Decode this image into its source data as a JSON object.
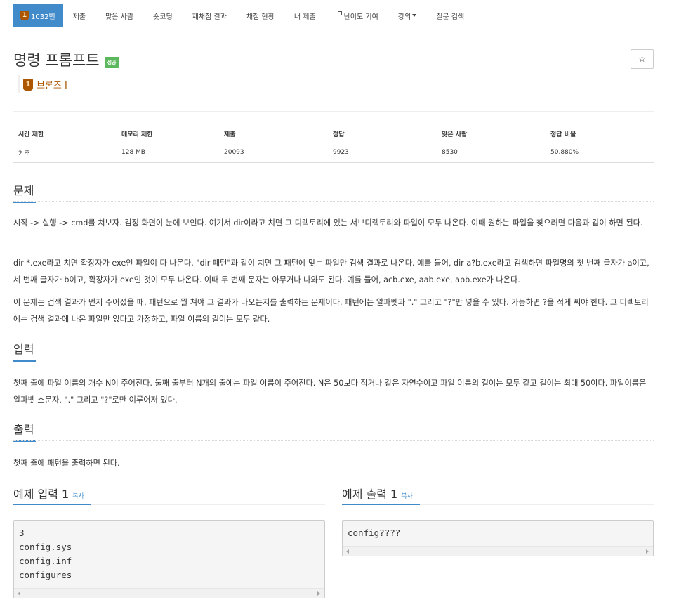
{
  "nav": {
    "problem_number": "1032번",
    "medal_digit": "1",
    "items": [
      "제출",
      "맞은 사람",
      "숏코딩",
      "재채점 결과",
      "채점 현황",
      "내 제출"
    ],
    "difficulty": "난이도 기여",
    "lecture": "강의",
    "qna": "질문 검색"
  },
  "problem": {
    "title": "명령 프롬프트",
    "status_badge": "성공",
    "tier": "브론즈 I",
    "star": "☆"
  },
  "colors": {
    "accent": "#428bca",
    "bronze": "#ad5600",
    "success": "#5cb85c"
  },
  "info_table": {
    "headers": [
      "시간 제한",
      "메모리 제한",
      "제출",
      "정답",
      "맞은 사람",
      "정답 비율"
    ],
    "row": [
      "2 초",
      "128 MB",
      "20093",
      "9923",
      "8530",
      "50.880%"
    ]
  },
  "sections": {
    "problem": {
      "heading": "문제",
      "paragraphs": [
        "시작 -> 실행 -> cmd를 쳐보자. 검정 화면이 눈에 보인다. 여기서 dir이라고 치면 그 디렉토리에 있는 서브디렉토리와 파일이 모두 나온다. 이때 원하는 파일을 찾으려면 다음과 같이 하면 된다.",
        "dir *.exe라고 치면 확장자가 exe인 파일이 다 나온다. \"dir 패턴\"과 같이 치면 그 패턴에 맞는 파일만 검색 결과로 나온다. 예를 들어, dir a?b.exe라고 검색하면 파일명의 첫 번째 글자가 a이고, 세 번째 글자가 b이고, 확장자가 exe인 것이 모두 나온다. 이때 두 번째 문자는 아무거나 나와도 된다. 예를 들어, acb.exe, aab.exe, apb.exe가 나온다.",
        "이 문제는 검색 결과가 먼저 주어졌을 때, 패턴으로 뭘 쳐야 그 결과가 나오는지를 출력하는 문제이다. 패턴에는 알파벳과 \".\" 그리고 \"?\"만 넣을 수 있다. 가능하면 ?을 적게 써야 한다. 그 디렉토리에는 검색 결과에 나온 파일만 있다고 가정하고, 파일 이름의 길이는 모두 같다."
      ]
    },
    "input": {
      "heading": "입력",
      "text": "첫째 줄에 파일 이름의 개수 N이 주어진다. 둘째 줄부터 N개의 줄에는 파일 이름이 주어진다. N은 50보다 작거나 같은 자연수이고 파일 이름의 길이는 모두 같고 길이는 최대 50이다. 파일이름은 알파벳 소문자, \".\" 그리고 \"?\"로만 이루어져 있다."
    },
    "output": {
      "heading": "출력",
      "text": "첫째 줄에 패턴을 출력하면 된다."
    }
  },
  "samples": {
    "input_title": "예제 입력 1",
    "output_title": "예제 출력 1",
    "copy_label": "복사",
    "input_code": "3\nconfig.sys\nconfig.inf\nconfigures",
    "output_code": "config????"
  }
}
